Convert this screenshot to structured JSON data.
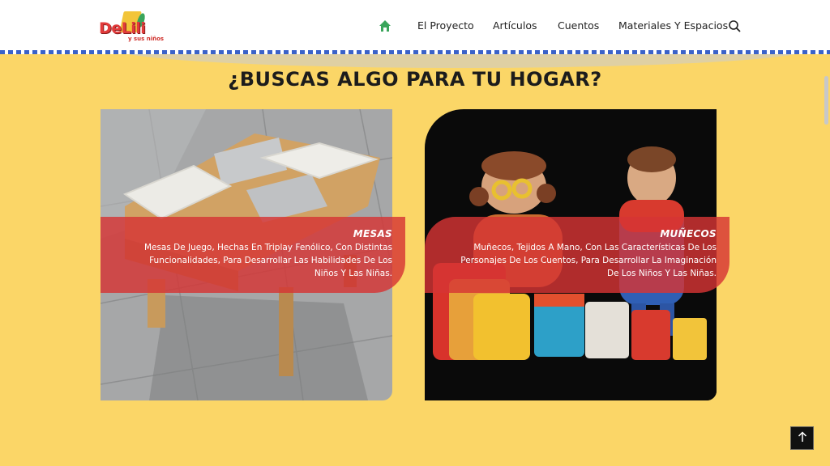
{
  "logo": {
    "name": "DeLili",
    "sub": "y sus niños"
  },
  "nav": {
    "home_icon": "home-icon",
    "items": [
      "El Proyecto",
      "Artículos",
      "Cuentos",
      "Materiales Y Espacios"
    ],
    "search_icon": "search-icon"
  },
  "section": {
    "title": "¿BUSCAS ALGO PARA TU HOGAR?"
  },
  "cards": [
    {
      "title": "MESAS",
      "description": "Mesas De Juego, Hechas En Triplay Fenólico, Con Distintas Funcionalidades, Para Desarrollar Las Habilidades De Los Niños Y Las Niñas."
    },
    {
      "title": "MUÑECOS",
      "description": "Muñecos, Tejidos A Mano, Con Las Características De Los Personajes De Los Cuentos, Para Desarrollar La Imaginación De Los Niños Y Las Niñas."
    }
  ],
  "back_to_top_icon": "arrow-up-icon",
  "colors": {
    "background": "#fbd667",
    "accent_red": "#d63434",
    "nav_home": "#3aa55b",
    "border_blue": "#3a62c9"
  }
}
